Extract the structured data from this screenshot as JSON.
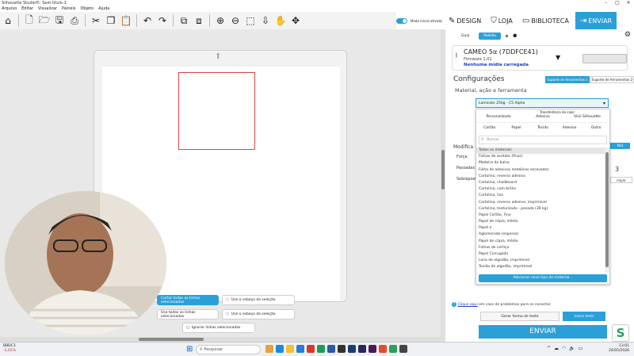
{
  "window": {
    "title": "Silhouette Studio®: Sem título-1",
    "controls": [
      "–",
      "□",
      "✕"
    ]
  },
  "menu": [
    "Arquivo",
    "Editar",
    "Visualizar",
    "Painéis",
    "Objeto",
    "Ajuda"
  ],
  "top_nav": {
    "toggle_label": "Modo inicial ativado",
    "design": "DESIGN",
    "loja": "LOJA",
    "biblioteca": "BIBLIOTECA",
    "enviar": "ENVIAR"
  },
  "floating_buttons": {
    "cut_selected": "Cortar todas as linhas selecionadas",
    "use_outline": "Use o esboço da seleção",
    "use_all_selected": "Use todas as linhas selecionadas",
    "use_outline2": "Use o esboço da seleção",
    "ignore": "Ignorar linhas selecionadas"
  },
  "panel": {
    "tabs": [
      "Guia",
      "Padrão"
    ],
    "device": {
      "name": "CAMEO 5α (7DDFCE41)",
      "firmware": "Firmware 1.01",
      "media": "Nenhuma mídia carregada"
    },
    "config_title": "Configurações",
    "support_tab1": "Suporte de ferramentas 1",
    "support_tab2": "Suporte de ferramentas 2",
    "material_label": "Material, ação e ferramenta",
    "selected_material": "Lamicote 250g - C5 Alpha",
    "categories_row1": [
      "Personalizado",
      "Adesivo",
      "Vinil Silhouette"
    ],
    "categories_row2": [
      "Cartão",
      "Papel",
      "Tecido",
      "Adesivo",
      "Outro"
    ],
    "transfer_label": "Transferência de calor",
    "search_placeholder": "Buscar",
    "materials": [
      "Todos os materiais",
      "Folhas de acetato (finas)",
      "Madeira de balsa",
      "Folha de adesivos metálicos escovados",
      "Cartolina, reverso adesivo",
      "Cartolina, chalkboard",
      "Cartolina, com brilho",
      "Cartolina, lisa",
      "Cartolina, reverso adesivo, imprimível",
      "Cartolina, texturizado - pesada (39 kg)",
      "Papel Cartão, Fino",
      "Papel de cópia, médio",
      "Papel o",
      "Aglomerado (espesso)",
      "Papel de cópia, médio",
      "Folhas de cortiça",
      "Papel Corrugado",
      "Lona de algodão, imprimível",
      "Tecido de algodão, imprimível"
    ],
    "add_material": "Adicionar novo tipo de material...",
    "behind": {
      "modifica": "Modifica",
      "forca": "Força",
      "passadas": "Passadas",
      "sobreposicao": "Sobreposição",
      "mat_badge": "Mat",
      "num": "3",
      "limpar": "impar"
    },
    "help_link": "Clique aqui",
    "help_text": " em caso de problemas para se conectar.",
    "test_button": "Gerar forma de teste",
    "test_button2": "Iniciar teste",
    "send_button": "ENVIAR",
    "logo": "S"
  },
  "taskbar": {
    "weather_name": "BBDC3",
    "weather_value": "-1,05%",
    "search_placeholder": "Pesquisar",
    "time": "13:01",
    "date": "24/05/2026"
  },
  "colors": {
    "accent": "#2aa0d8",
    "shape_stroke": "#e04444",
    "link": "#1f3fbf"
  }
}
